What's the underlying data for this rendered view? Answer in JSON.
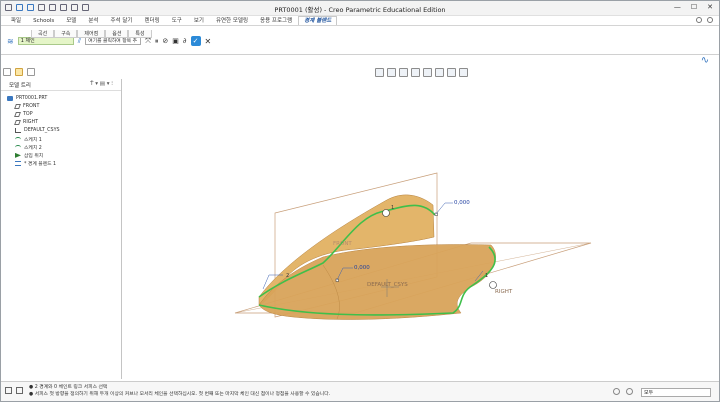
{
  "window": {
    "title": "PRT0001 (활성) - Creo Parametric Educational Edition"
  },
  "ribbon_tabs": [
    "파일",
    "Schools",
    "모델",
    "분석",
    "주석 달기",
    "렌더링",
    "도구",
    "보기",
    "유연한 모델링",
    "응용 프로그램",
    "경계 블렌드"
  ],
  "ribbon": {
    "field_value": "1 체인",
    "select_value": "여기를 클릭하여 항목 추",
    "subtabs": [
      "곡선",
      "구속",
      "제어점",
      "옵션",
      "특성"
    ],
    "style_label": "가운"
  },
  "model_tree": {
    "header": "모델 트리",
    "nodes": [
      {
        "label": "PRT0001.PRT",
        "icon": "part-icon",
        "level": 0
      },
      {
        "label": "FRONT",
        "icon": "datum-plane-icon",
        "level": 1
      },
      {
        "label": "TOP",
        "icon": "datum-plane-icon",
        "level": 1
      },
      {
        "label": "RIGHT",
        "icon": "datum-plane-icon",
        "level": 1
      },
      {
        "label": "DEFAULT_CSYS",
        "icon": "csys-icon",
        "level": 1
      },
      {
        "label": "스케치 1",
        "icon": "sketch-icon",
        "level": 1
      },
      {
        "label": "스케치 2",
        "icon": "sketch-icon",
        "level": 1
      },
      {
        "label": "삽입 위치",
        "icon": "insert-here-icon",
        "level": 1
      },
      {
        "label": "* 경계 블렌드 1",
        "icon": "boundary-blend-icon",
        "level": 1
      }
    ]
  },
  "graphics": {
    "labels": {
      "top_value": "0,000",
      "mid_value": "0,000",
      "pt1_top": "1",
      "pt2": "2",
      "pt1_right": "1",
      "csys": "DEFAULT_CSYS",
      "right_plane": "RIGHT",
      "front_plane": "FRONT"
    }
  },
  "status": {
    "line1": "● 2 경계와 0 체인트 링크 서피스 선택",
    "line2": "● 서피스 첫 방향을 정의하기 위해 두개 이상의 커브나 모서리 체인을 선택하십시오. 첫 번째 또는 마지막 체인 대신 점이나 정점을 사용할 수 있습니다.",
    "filter_value": "모두"
  },
  "colors": {
    "surface_fill": "#d9a45a",
    "boundary_curve": "#3fbf4a",
    "datum_plane": "#c89f7a"
  }
}
